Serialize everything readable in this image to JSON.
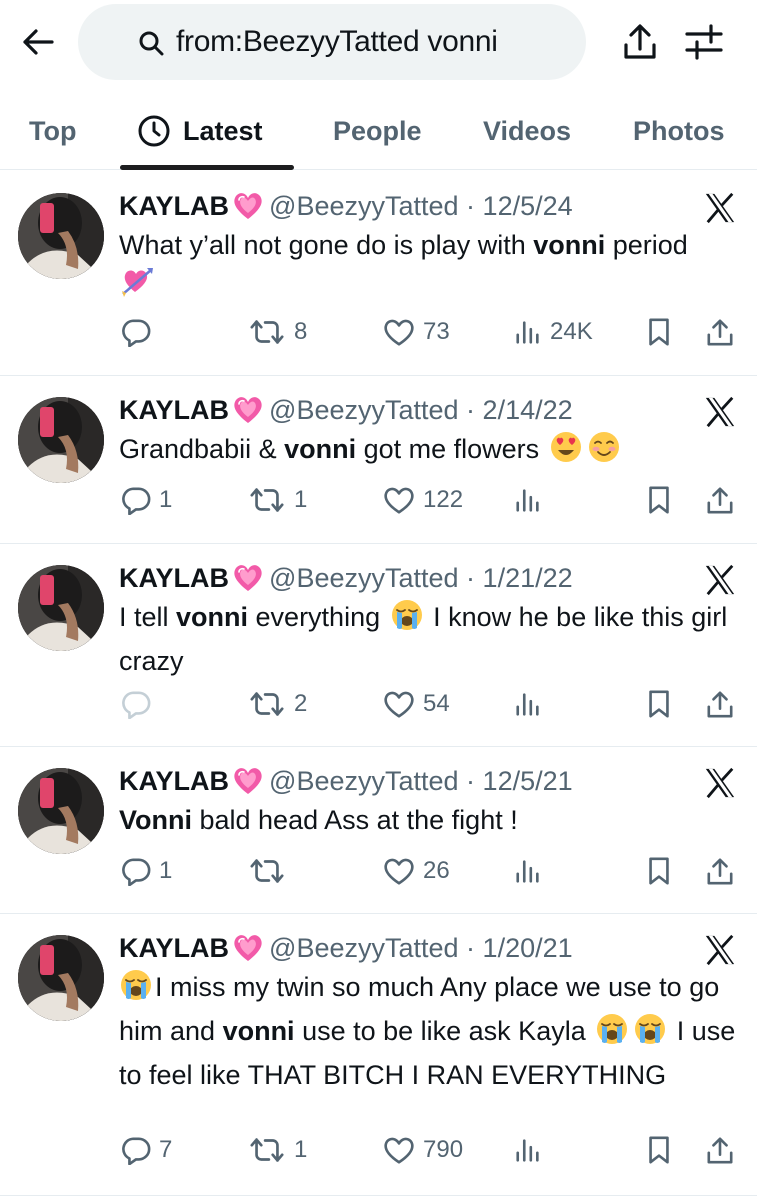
{
  "header": {
    "search_query": "from:BeezyyTatted vonni"
  },
  "tabs": [
    {
      "label": "Top"
    },
    {
      "label": "Latest"
    },
    {
      "label": "People"
    },
    {
      "label": "Videos"
    },
    {
      "label": "Photos"
    }
  ],
  "tweets": [
    {
      "name": "KAYLAB",
      "handle": "@BeezyyTatted",
      "date": "12/5/24",
      "text_before": "What y’all not gone do is play with ",
      "highlight": "vonni",
      "text_after": " period",
      "emoji": "💘",
      "replies": "",
      "retweets": "8",
      "likes": "73",
      "views": "24K"
    },
    {
      "name": "KAYLAB",
      "handle": "@BeezyyTatted",
      "date": "2/14/22",
      "text_before": "Grandbabii & ",
      "highlight": "vonni",
      "text_after": " got me flowers ",
      "emoji": "😍 ☺️",
      "replies": "1",
      "retweets": "1",
      "likes": "122",
      "views": ""
    },
    {
      "name": "KAYLAB",
      "handle": "@BeezyyTatted",
      "date": "1/21/22",
      "text_before": "I tell ",
      "highlight": "vonni",
      "text_mid": " everything ",
      "emoji": "😭",
      "text_after": " I know he be like this girl  crazy",
      "replies": "",
      "retweets": "2",
      "likes": "54",
      "views": ""
    },
    {
      "name": "KAYLAB",
      "handle": "@BeezyyTatted",
      "date": "12/5/21",
      "highlight": "Vonni",
      "text_after": " bald head Ass at the fight !",
      "replies": "1",
      "retweets": "",
      "likes": "26",
      "views": ""
    },
    {
      "name": "KAYLAB",
      "handle": "@BeezyyTatted",
      "date": "1/20/21",
      "emoji_lead": "😭",
      "text_before": "I miss my twin so much Any place we use to go him and ",
      "highlight": "vonni",
      "text_mid": " use to be like ask Kayla ",
      "emoji": "😭😭",
      "text_after": " I use to feel like THAT BITCH I RAN EVERYTHING",
      "replies": "7",
      "retweets": "1",
      "likes": "790",
      "views": ""
    }
  ],
  "colors": {
    "text_primary": "#0f1419",
    "text_secondary": "#536471",
    "divider": "#e6ecf0",
    "search_bg": "#eff3f4",
    "heart_pink": "#f25aa8"
  },
  "icons": {
    "back": "arrow-left-icon",
    "search": "search-icon",
    "share": "share-icon",
    "filter": "filter-icon",
    "clock": "clock-icon",
    "x_logo": "x-logo-icon",
    "reply": "reply-icon",
    "retweet": "retweet-icon",
    "like": "like-icon",
    "views": "views-icon",
    "bookmark": "bookmark-icon"
  }
}
